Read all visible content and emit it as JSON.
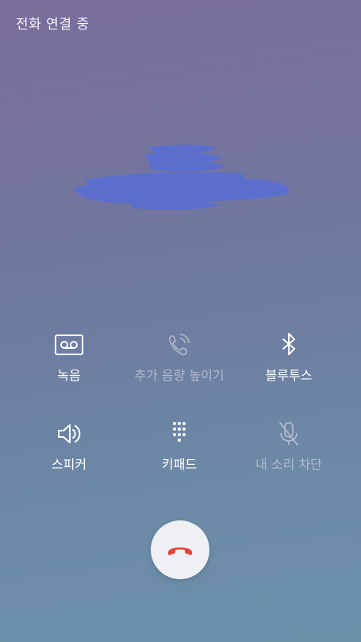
{
  "status": {
    "text": "전화 연결 중"
  },
  "buttons": {
    "record": {
      "label": "녹음",
      "icon": "voicemail-icon",
      "enabled": true
    },
    "add_volume": {
      "label": "추가 음량 높이기",
      "icon": "phone-volume-icon",
      "enabled": false
    },
    "bluetooth": {
      "label": "블루투스",
      "icon": "bluetooth-icon",
      "enabled": true
    },
    "speaker": {
      "label": "스피커",
      "icon": "speaker-icon",
      "enabled": true
    },
    "keypad": {
      "label": "키패드",
      "icon": "keypad-icon",
      "enabled": true
    },
    "mute": {
      "label": "내 소리 차단",
      "icon": "mic-off-icon",
      "enabled": false
    }
  },
  "end_call": {
    "icon": "end-call-icon",
    "color": "#e0463d"
  },
  "colors": {
    "gradient_top": "#7a6d9b",
    "gradient_bottom": "#6c8fa8",
    "redaction": "#5b6fd1",
    "disabled": "#b3b9cc"
  }
}
